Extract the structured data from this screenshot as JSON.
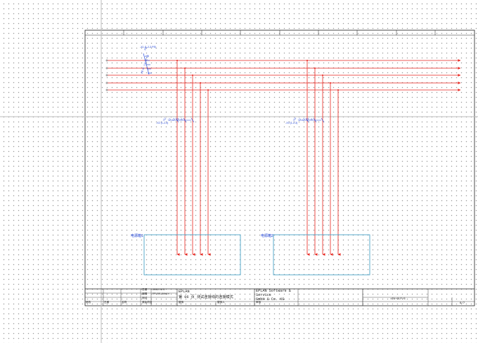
{
  "terminals": {
    "device_caption": "-X1 (1-2-3.PE)",
    "top": [
      "-X1",
      "L1",
      "L2",
      "L3",
      "N",
      "PE"
    ],
    "left_group": [
      "-X2",
      "L1",
      "L2",
      "L3",
      "N"
    ],
    "right_group": [
      "-X3",
      "L1",
      "L2",
      "L3",
      "N"
    ],
    "left_group_caption": "-X2 (1-2-3)",
    "right_group_caption": "-X3 (1-2-3)"
  },
  "boxes": {
    "left_label": "电源箱1",
    "right_label": "电源箱2"
  },
  "title_block": {
    "company": "EPLAN",
    "drawing_title": "第 06 页 测试连接线的连接模式",
    "vendor_line1": "EPLAN Software &",
    "vendor_line2": "Service",
    "vendor_line3": "GmbH & Co. KG",
    "date_value": "2022/4/5",
    "editor_value": "EPLAN-Admin",
    "check_label": "审核",
    "cells": {
      "a": "修改",
      "b": "日期",
      "c": "名称",
      "d": "日期",
      "e": "编辑",
      "f": "测试",
      "g": "原始项目",
      "h": "替换",
      "i": "替换人"
    },
    "page_ref": "=PA+OLP/6",
    "page_total": "6/7"
  },
  "colors": {
    "wire": "#e8231c",
    "box": "#4aa3c7",
    "text_blue": "#1a3fd6",
    "frame": "#222222"
  }
}
